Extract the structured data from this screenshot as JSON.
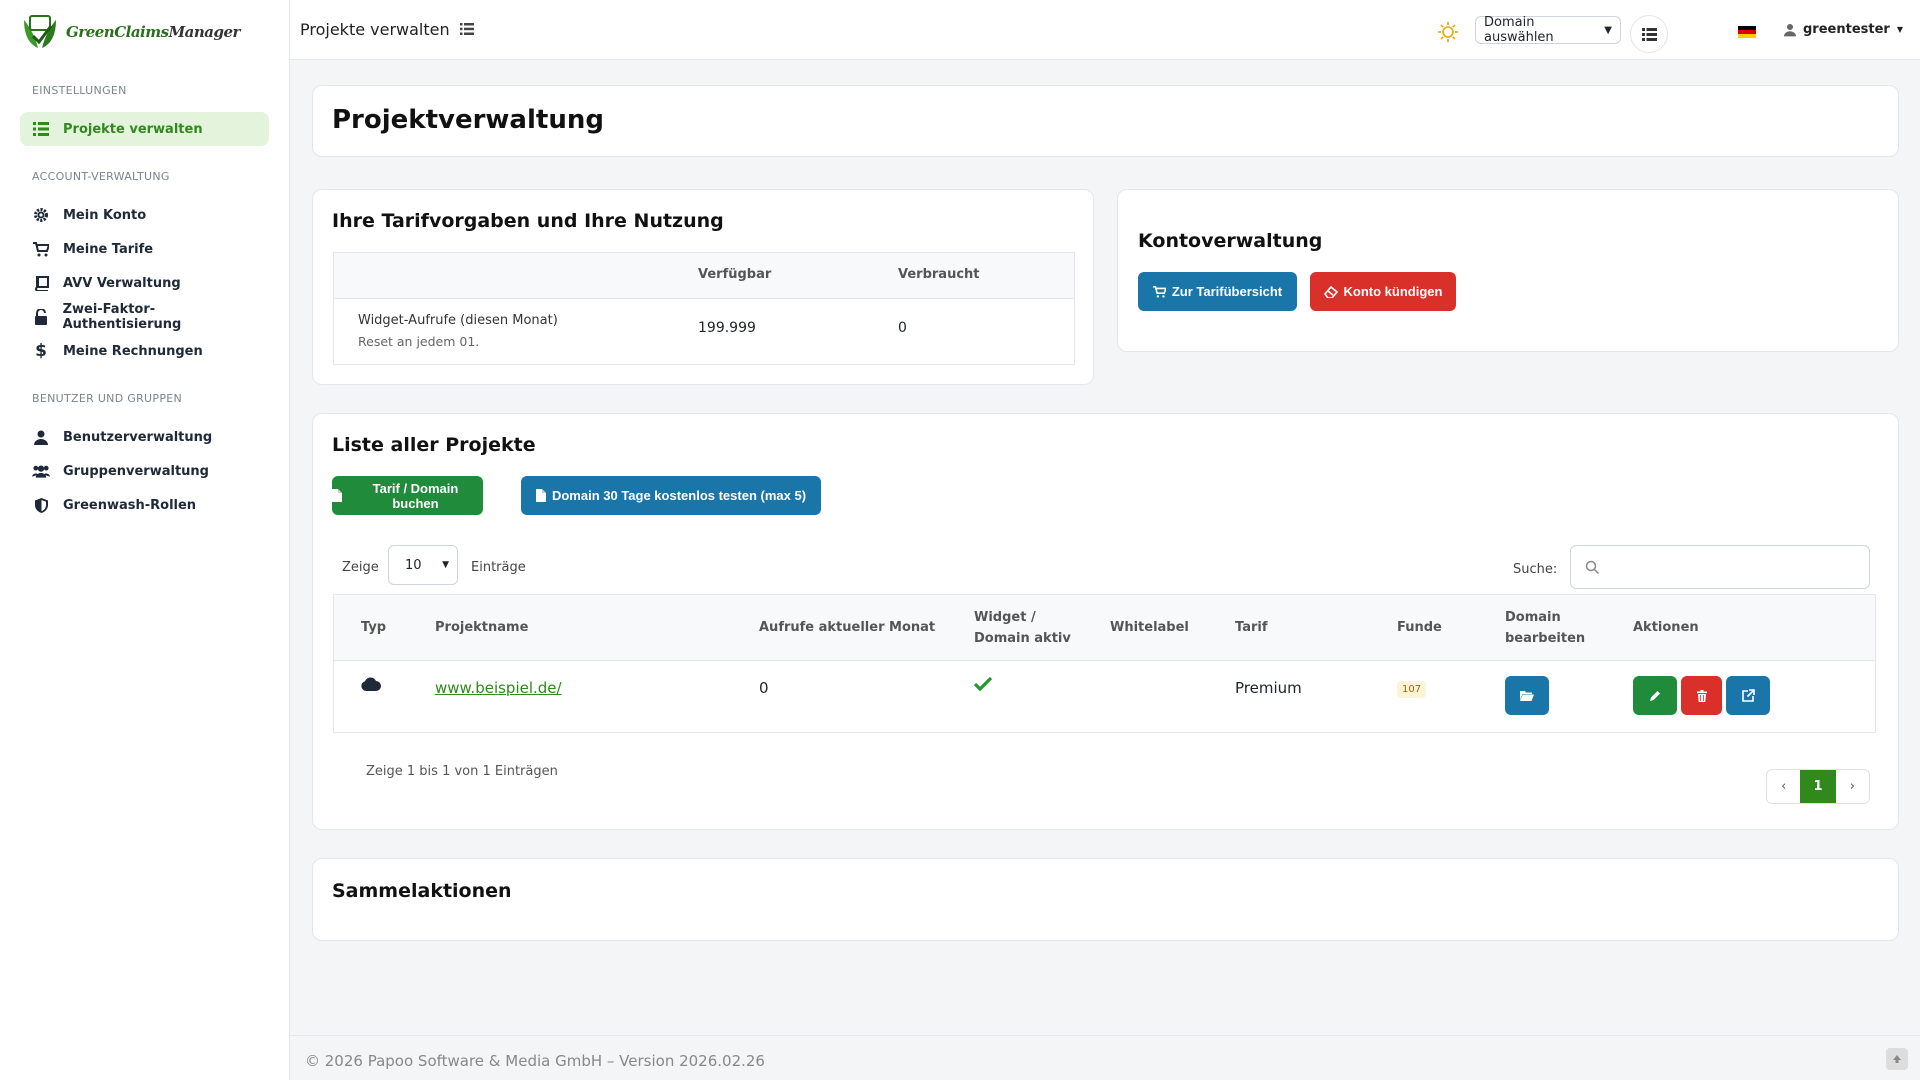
{
  "app": {
    "brand_part1": "GreenClaims",
    "brand_part2": "Manager"
  },
  "topbar": {
    "title": "Projekte verwalten",
    "domain_select": "Domain auswählen",
    "username": "greentester"
  },
  "sidebar": {
    "sections": [
      {
        "label": "EINSTELLUNGEN"
      },
      {
        "label": "ACCOUNT-VERWALTUNG"
      },
      {
        "label": "BENUTZER UND GRUPPEN"
      }
    ],
    "items": [
      {
        "label": "Projekte verwalten",
        "icon": "list-icon",
        "active": true
      },
      {
        "label": "Mein Konto",
        "icon": "gear-icon"
      },
      {
        "label": "Meine Tarife",
        "icon": "cart-icon"
      },
      {
        "label": "AVV Verwaltung",
        "icon": "book-icon"
      },
      {
        "label": "Zwei-Faktor-Authentisierung",
        "icon": "lock-icon"
      },
      {
        "label": "Meine Rechnungen",
        "icon": "dollar-icon"
      },
      {
        "label": "Benutzerverwaltung",
        "icon": "user-icon"
      },
      {
        "label": "Gruppenverwaltung",
        "icon": "users-icon"
      },
      {
        "label": "Greenwash-Rollen",
        "icon": "shield-icon"
      }
    ]
  },
  "main": {
    "title": "Projektverwaltung",
    "tarif": {
      "title": "Ihre Tarifvorgaben und Ihre Nutzung",
      "col_available": "Verfügbar",
      "col_used": "Verbraucht",
      "row_label": "Widget-Aufrufe (diesen Monat)",
      "row_sub": "Reset an jedem 01.",
      "available": "199.999",
      "used": "0"
    },
    "konto": {
      "title": "Kontoverwaltung",
      "btn_overview": "Zur Tarifübersicht",
      "btn_cancel": "Konto kündigen"
    },
    "projects": {
      "title": "Liste aller Projekte",
      "btn_book": "Tarif / Domain buchen",
      "btn_trial": "Domain 30 Tage kostenlos testen (max 5)",
      "show_label": "Zeige",
      "show_value": "10",
      "entries_label": "Einträge",
      "search_label": "Suche:",
      "search_value": "",
      "columns": {
        "typ": "Typ",
        "name": "Projektname",
        "calls": "Aufrufe aktueller Monat",
        "widget_1": "Widget /",
        "widget_2": "Domain aktiv",
        "whitelabel": "Whitelabel",
        "tarif": "Tarif",
        "funde": "Funde",
        "domain_1": "Domain",
        "domain_2": "bearbeiten",
        "actions": "Aktionen"
      },
      "rows": [
        {
          "name": "www.beispiel.de/",
          "calls": "0",
          "tarif": "Premium",
          "funde": "107"
        }
      ],
      "info": "Zeige 1 bis 1 von 1 Einträgen",
      "pager": {
        "prev": "‹",
        "current": "1",
        "next": "›"
      }
    },
    "bulk": {
      "title": "Sammelaktionen"
    }
  },
  "footer": {
    "text": "© 2026 Papoo Software & Media GmbH – Version 2026.02.26"
  },
  "colors": {
    "accent": "#2f8a1b",
    "blue": "#1a76a8",
    "red": "#d9302a",
    "green": "#1f8b3b"
  }
}
